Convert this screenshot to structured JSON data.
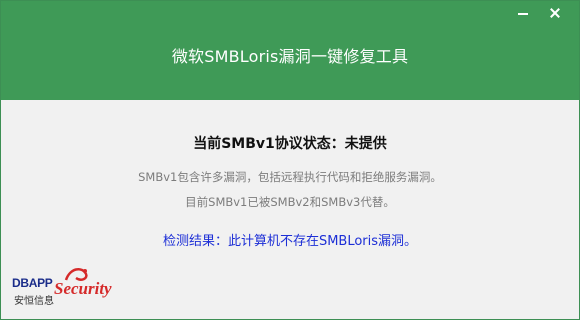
{
  "window": {
    "title": "微软SMBLoris漏洞一键修复工具",
    "header_color": "#3f9a57",
    "buttons": {
      "minimize_icon": "minimize-icon",
      "close_icon": "close-icon"
    }
  },
  "content": {
    "status_text": "当前SMBv1协议状态：未提供",
    "description_line1": "SMBv1包含许多漏洞，包括远程执行代码和拒绝服务漏洞。",
    "description_line2": "目前SMBv1已被SMBv2和SMBv3代替。",
    "result_text": "检测结果：此计算机不存在SMBLoris漏洞。",
    "result_color": "#1c2ed6"
  },
  "logo": {
    "brand_en_part1": "DBAPP",
    "brand_en_part2": "Security",
    "brand_cn": "安恒信息",
    "brand_red": "#d52a2a",
    "brand_blue": "#1b2d8a"
  }
}
